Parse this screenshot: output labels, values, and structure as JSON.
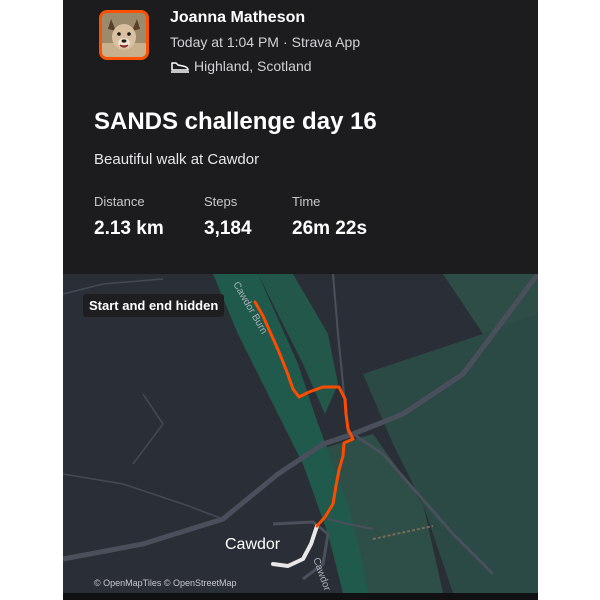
{
  "athlete": {
    "name": "Joanna Matheson",
    "date_time": "Today at 1:04 PM",
    "separator": "·",
    "app": "Strava App",
    "location": "Highland, Scotland",
    "avatar_icon": "dog-photo-avatar",
    "location_icon": "shoe-icon"
  },
  "activity": {
    "title": "SANDS challenge day 16",
    "description": "Beautiful walk at Cawdor"
  },
  "stats": [
    {
      "label": "Distance",
      "value": "2.13 km"
    },
    {
      "label": "Steps",
      "value": "3,184"
    },
    {
      "label": "Time",
      "value": "26m 22s"
    }
  ],
  "map": {
    "privacy_badge": "Start and end hidden",
    "place_label": "Cawdor",
    "road_label_1": "Cawdor Burn",
    "road_label_2": "Cawdor",
    "attribution": "© OpenMapTiles © OpenStreetMap",
    "route_color": "#fc4c02",
    "hidden_route_color": "#e8e8e8",
    "water_color": "#1f5a4d",
    "field_color": "#2b4a45",
    "road_color": "#4a505b"
  },
  "colors": {
    "accent": "#fc5200",
    "card_background": "#1c1c1e"
  }
}
